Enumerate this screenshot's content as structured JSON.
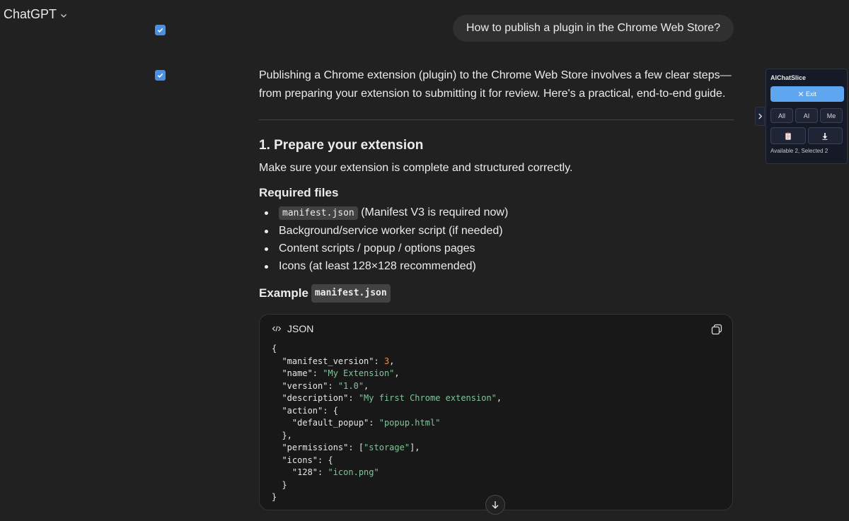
{
  "header": {
    "model_name": "ChatGPT"
  },
  "user_message": {
    "text": "How to publish a plugin in the Chrome Web Store?"
  },
  "answer": {
    "intro": "Publishing a Chrome extension (plugin) to the Chrome Web Store involves a few clear steps—from preparing your extension to submitting it for review. Here's a practical, end-to-end guide.",
    "section_heading": "1. Prepare your extension",
    "section_paragraph": "Make sure your extension is complete and structured correctly.",
    "required_files_heading": "Required files",
    "bullets": {
      "b0_code": "manifest.json",
      "b0_text": " (Manifest V3 is required now)",
      "b1": "Background/service worker script (if needed)",
      "b2": "Content scripts / popup / options pages",
      "b3": "Icons (at least 128×128 recommended)"
    },
    "example_heading": "Example",
    "example_code": "manifest.json",
    "code_language": "JSON",
    "code": {
      "l1": "{",
      "l2_key": "  \"manifest_version\": ",
      "l2_val": "3",
      "l3_key": "  \"name\": ",
      "l3_val": "\"My Extension\"",
      "l4_key": "  \"version\": ",
      "l4_val": "\"1.0\"",
      "l5_key": "  \"description\": ",
      "l5_val": "\"My first Chrome extension\"",
      "l6": "  \"action\": {",
      "l7_key": "    \"default_popup\": ",
      "l7_val": "\"popup.html\"",
      "l8": "  },",
      "l9_key": "  \"permissions\": [",
      "l9_val": "\"storage\"",
      "l9_end": "],",
      "l10": "  \"icons\": {",
      "l11_key": "    \"128\": ",
      "l11_val": "\"icon.png\"",
      "l12": "  }",
      "l13": "}",
      "comma": ","
    }
  },
  "panel": {
    "title": "AIChatSlice",
    "exit_label": "Exit",
    "filter_all": "All",
    "filter_ai": "AI",
    "filter_me": "Me",
    "status": "Available 2, Selected 2"
  },
  "colors": {
    "background": "#212121",
    "checkbox": "#4a90e2",
    "exit_button": "#5ea6f0",
    "code_number": "#f08d49",
    "code_string": "#7ec699"
  }
}
